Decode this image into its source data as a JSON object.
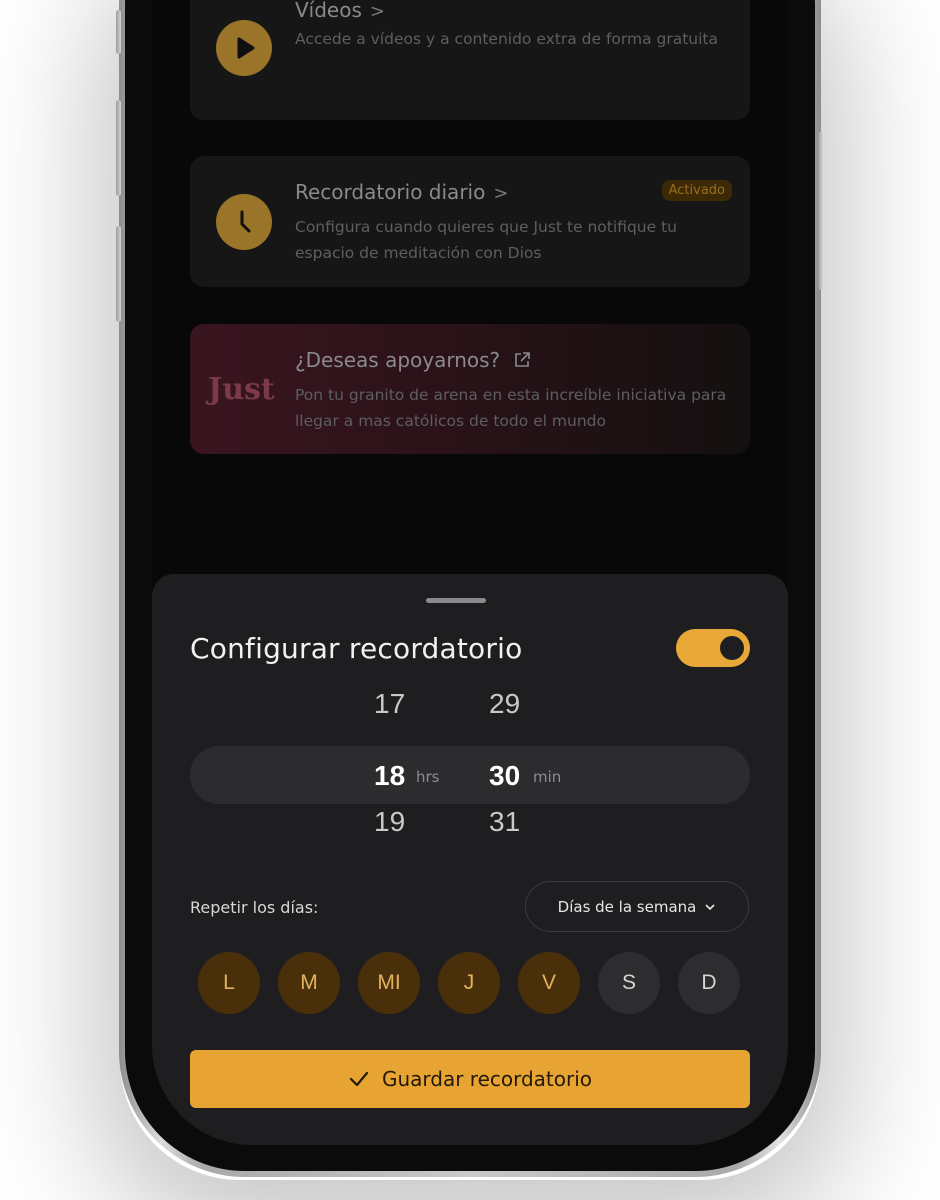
{
  "cards": {
    "videos": {
      "title": "Vídeos",
      "chevron": ">",
      "description": "Accede a vídeos y a contenido extra de forma gratuita",
      "icon": "play-icon"
    },
    "reminder": {
      "title": "Recordatorio diario",
      "chevron": ">",
      "badge": "Activado",
      "description": "Configura cuando quieres que Just te notifique tu espacio de meditación con Dios",
      "icon": "clock-icon"
    },
    "support": {
      "logo": "Just",
      "title": "¿Deseas apoyarnos?",
      "description": "Pon tu granito de arena en esta increíble iniciativa para llegar a mas católicos de todo el mundo",
      "icon": "external-link-icon"
    }
  },
  "sheet": {
    "title": "Configurar recordatorio",
    "toggle_on": true,
    "picker": {
      "hours": [
        "17",
        "18",
        "19"
      ],
      "minutes": [
        "29",
        "30",
        "31"
      ],
      "hours_unit": "hrs",
      "minutes_unit": "min"
    },
    "repeat_label": "Repetir los días:",
    "repeat_dropdown": "Días de la semana",
    "days": [
      {
        "label": "L",
        "active": true
      },
      {
        "label": "M",
        "active": true
      },
      {
        "label": "MI",
        "active": true
      },
      {
        "label": "J",
        "active": true
      },
      {
        "label": "V",
        "active": true
      },
      {
        "label": "S",
        "active": false
      },
      {
        "label": "D",
        "active": false
      }
    ],
    "save_label": "Guardar recordatorio"
  },
  "colors": {
    "accent": "#E7A433",
    "day_active_bg": "#4A300A",
    "day_inactive_bg": "#2D2D30",
    "sheet_bg": "#1E1E20"
  }
}
